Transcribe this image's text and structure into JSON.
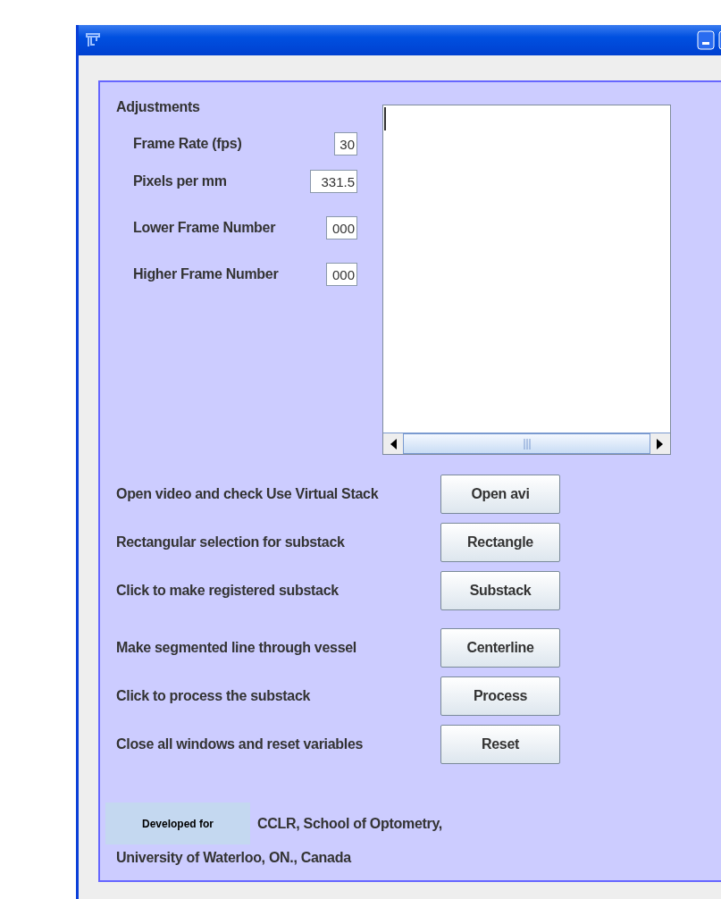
{
  "adjustments": {
    "heading": "Adjustments",
    "fields": [
      {
        "label": "Frame Rate (fps)",
        "value": "30"
      },
      {
        "label": "Pixels per mm",
        "value": "331.5"
      },
      {
        "label": "Lower Frame Number",
        "value": "000"
      },
      {
        "label": "Higher Frame Number",
        "value": "000"
      }
    ]
  },
  "actions": [
    {
      "description": "Open video and check Use Virtual Stack",
      "button": "Open avi"
    },
    {
      "description": "Rectangular selection for substack",
      "button": "Rectangle"
    },
    {
      "description": "Click to make registered substack",
      "button": "Substack"
    },
    {
      "description": "Make segmented line through vessel",
      "button": "Centerline"
    },
    {
      "description": "Click to process the substack",
      "button": "Process"
    },
    {
      "description": "Close all windows and reset variables",
      "button": "Reset"
    }
  ],
  "footer": {
    "badge": "Developed for",
    "line_1": "CCLR, School of Optometry,",
    "line_2": "University of Waterloo, ON., Canada"
  }
}
